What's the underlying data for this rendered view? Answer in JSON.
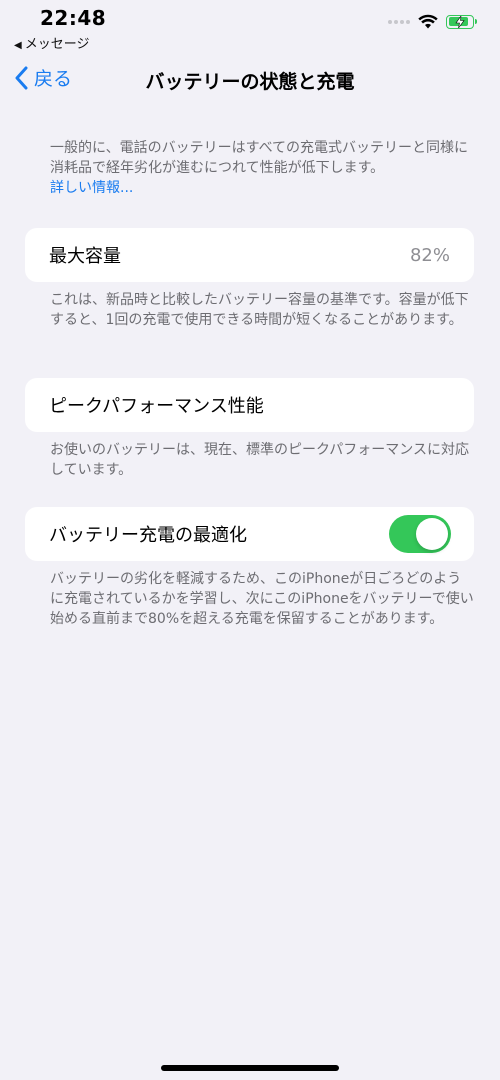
{
  "status_bar": {
    "time": "22:48",
    "back_app": "メッセージ",
    "icons": [
      "wifi-icon",
      "battery-charging-icon"
    ],
    "battery_level": 0.85,
    "accent_color": "#34c759"
  },
  "nav": {
    "back_label": "戻る",
    "title": "バッテリーの状態と充電",
    "tint_color": "#1a7cf0"
  },
  "intro": {
    "text": "一般的に、電話のバッテリーはすべての充電式バッテリーと同様に消耗品で経年劣化が進むにつれて性能が低下します。",
    "link": "詳しい情報..."
  },
  "max_capacity": {
    "label": "最大容量",
    "value": "82%",
    "footer": "これは、新品時と比較したバッテリー容量の基準です。容量が低下すると、1回の充電で使用できる時間が短くなることがあります。"
  },
  "peak_performance": {
    "label": "ピークパフォーマンス性能",
    "footer": "お使いのバッテリーは、現在、標準のピークパフォーマンスに対応しています。"
  },
  "optimized_charging": {
    "label": "バッテリー充電の最適化",
    "enabled": true,
    "footer": "バッテリーの劣化を軽減するため、このiPhoneが日ごろどのように充電されているかを学習し、次にこのiPhoneをバッテリーで使い始める直前まで80%を超える充電を保留することがあります。"
  }
}
